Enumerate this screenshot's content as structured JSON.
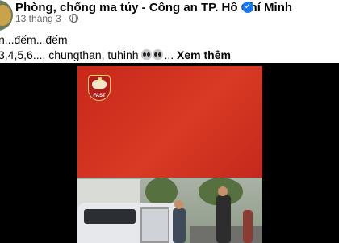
{
  "header": {
    "page_name": "Phòng, chống ma túy - Công an TP. Hồ Chí Minh",
    "verified_glyph": "✓",
    "date": "13 tháng 3",
    "separator": "·",
    "audience_icon": "globe-icon"
  },
  "caption": {
    "line1": "n...đếm...đếm",
    "line2": "3,4,5,6.... chungthan, tuhinh ",
    "ellipsis": "...",
    "see_more": "Xem thêm",
    "emoji": "alien-icon"
  },
  "video": {
    "logo_text": "FAST",
    "colors": {
      "panel": "#c8271a",
      "background": "#000000"
    }
  },
  "colors": {
    "verified": "#1877f2",
    "meta_text": "#65676b",
    "text": "#050505"
  }
}
